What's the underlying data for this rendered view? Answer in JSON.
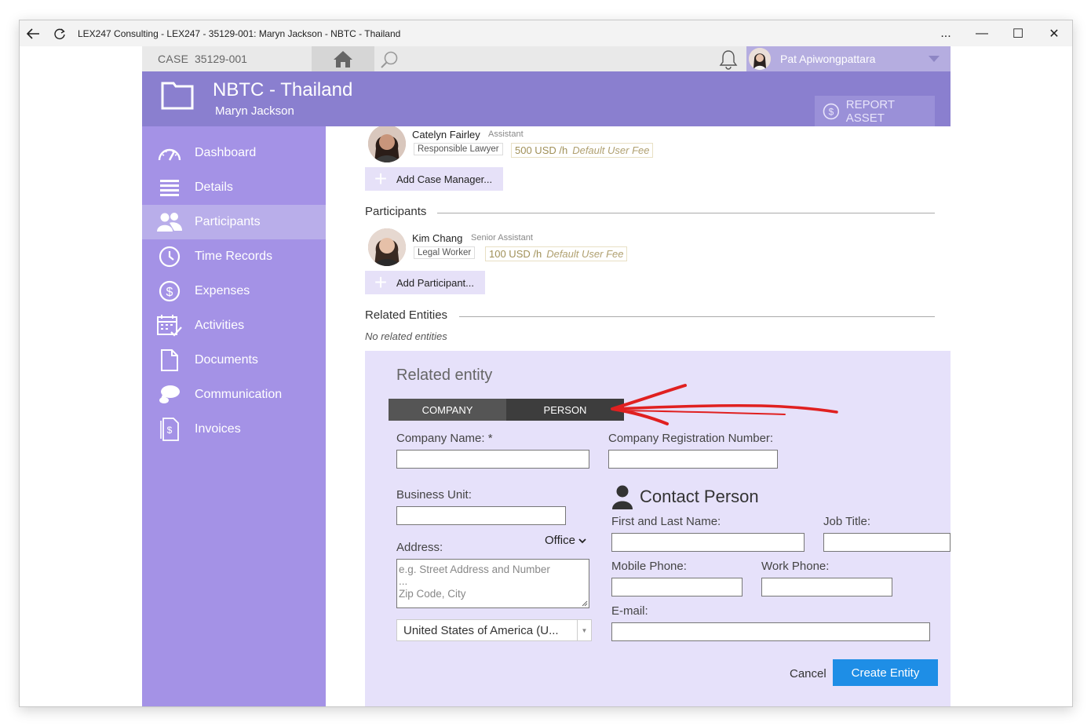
{
  "window": {
    "title": "LEX247 Consulting - LEX247 - 35129-001: Maryn Jackson - NBTC - Thailand",
    "controls": [
      "...",
      "—",
      "☐",
      "✕"
    ]
  },
  "topbar": {
    "case_label": "CASE",
    "case_number": "35129-001",
    "user_name": "Pat Apiwongpattara"
  },
  "header": {
    "title": "NBTC - Thailand",
    "subtitle": "Maryn Jackson",
    "report_button": "REPORT ASSET"
  },
  "sidebar": {
    "items": [
      {
        "label": "Dashboard",
        "icon": "gauge-icon"
      },
      {
        "label": "Details",
        "icon": "list-icon"
      },
      {
        "label": "Participants",
        "icon": "people-icon",
        "active": true
      },
      {
        "label": "Time Records",
        "icon": "clock-icon"
      },
      {
        "label": "Expenses",
        "icon": "dollar-icon"
      },
      {
        "label": "Activities",
        "icon": "calendar-icon"
      },
      {
        "label": "Documents",
        "icon": "document-icon"
      },
      {
        "label": "Communication",
        "icon": "chat-icon"
      },
      {
        "label": "Invoices",
        "icon": "invoice-icon"
      }
    ]
  },
  "case_managers": {
    "person": {
      "name": "Catelyn Fairley",
      "role": "Assistant",
      "tag": "Responsible Lawyer",
      "fee": "500 USD /h",
      "fee_note": "Default User Fee"
    },
    "add_label": "Add Case Manager..."
  },
  "participants": {
    "title": "Participants",
    "person": {
      "name": "Kim Chang",
      "role": "Senior Assistant",
      "tag": "Legal Worker",
      "fee": "100 USD /h",
      "fee_note": "Default User Fee"
    },
    "add_label": "Add Participant..."
  },
  "related": {
    "title": "Related Entities",
    "empty_text": "No related entities"
  },
  "form": {
    "title": "Related entity",
    "seg_company": "COMPANY",
    "seg_person": "PERSON",
    "company_name_label": "Company Name: *",
    "company_reg_label": "Company Registration Number:",
    "business_unit_label": "Business Unit:",
    "address_label": "Address:",
    "office_label": "Office",
    "address_placeholder_1": "e.g. Street Address and Number",
    "address_placeholder_2": "...",
    "address_placeholder_3": "Zip Code, City",
    "country": "United States of America (U...",
    "contact_title": "Contact Person",
    "first_last_label": "First and Last Name:",
    "job_title_label": "Job Title:",
    "mobile_label": "Mobile Phone:",
    "work_label": "Work Phone:",
    "email_label": "E-mail:",
    "cancel": "Cancel",
    "create": "Create Entity"
  },
  "colors": {
    "sidebar": "#a492e6",
    "header": "#8a7fcf",
    "accent": "#1e8ee6",
    "annotation_arrow": "#e02020"
  }
}
